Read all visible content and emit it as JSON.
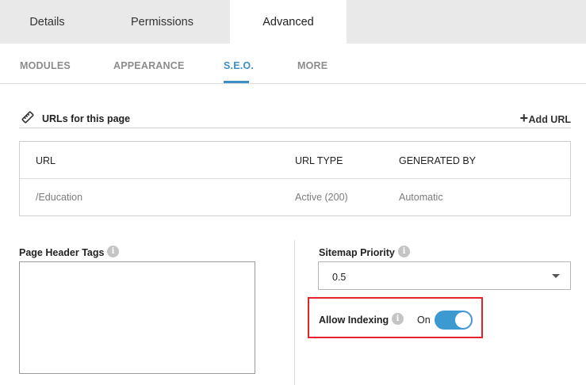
{
  "top_tabs": [
    {
      "label": "Details"
    },
    {
      "label": "Permissions"
    },
    {
      "label": "Advanced"
    }
  ],
  "active_top_tab": "Advanced",
  "sub_tabs": [
    {
      "label": "MODULES"
    },
    {
      "label": "APPEARANCE"
    },
    {
      "label": "S.E.O."
    },
    {
      "label": "MORE"
    }
  ],
  "active_sub_tab": "S.E.O.",
  "urls_section": {
    "title": "URLs for this page",
    "add_label": "Add URL",
    "columns": [
      "URL",
      "URL TYPE",
      "GENERATED BY"
    ],
    "rows": [
      [
        "/Education",
        "Active (200)",
        "Automatic"
      ]
    ]
  },
  "page_header_tags": {
    "label": "Page Header Tags",
    "value": ""
  },
  "sitemap_priority": {
    "label": "Sitemap Priority",
    "selected": "0.5"
  },
  "allow_indexing": {
    "label": "Allow Indexing",
    "state_label": "On",
    "enabled": true
  },
  "colors": {
    "accent": "#3d8fc5",
    "toggle_on": "#3d9ad1",
    "highlight": "#e5232a",
    "tab_bar": "#e9e9e9"
  },
  "icons": {
    "url_section": "link-tag-icon",
    "info": "info-icon",
    "add": "plus-icon",
    "select": "chevron-down-icon"
  }
}
